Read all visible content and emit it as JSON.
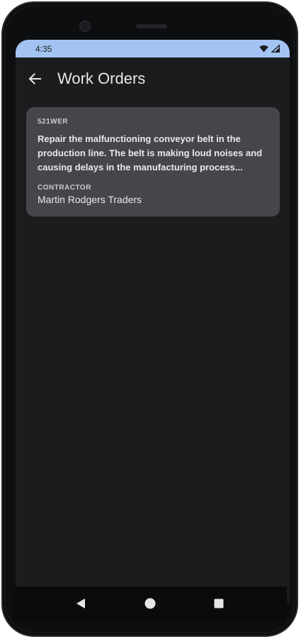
{
  "status_bar": {
    "time": "4:35",
    "icons": [
      "wifi-icon",
      "signal-icon"
    ]
  },
  "app_bar": {
    "back_icon": "arrow-left-icon",
    "title": "Work Orders"
  },
  "work_orders": [
    {
      "id": "521WER",
      "description": "Repair the malfunctioning conveyor belt in the production line. The belt is making loud noises and causing delays in the manufacturing process...",
      "contractor_label": "CONTRACTOR",
      "contractor": "Martin Rodgers Traders"
    }
  ],
  "nav_bar": {
    "icons": [
      "back-triangle-icon",
      "home-circle-icon",
      "recents-square-icon"
    ]
  },
  "colors": {
    "status_bar": "#a3c4f3",
    "background": "#1b1c1e",
    "card": "#45464c",
    "text_primary": "#e8e8ec",
    "text_secondary": "#c9cad0"
  }
}
